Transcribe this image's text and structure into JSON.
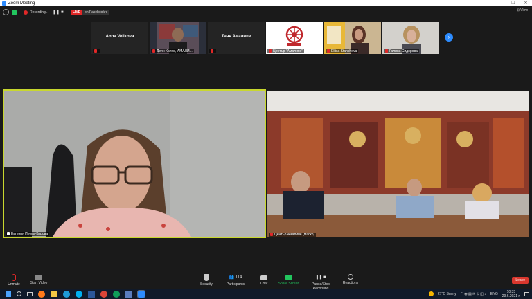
{
  "window": {
    "title": "Zoom Meeting"
  },
  "status": {
    "recording_label": "Recording...",
    "live_label": "LIVE",
    "live_target": "on Facebook",
    "view_label": "View"
  },
  "thumbnails": [
    {
      "name": "Anna Velikova",
      "label": ""
    },
    {
      "name": "",
      "label": "Деян Колев, АМАЛИ..."
    },
    {
      "name": "Таня Амалипе",
      "label": ""
    },
    {
      "name": "",
      "label": "Център \"Амалипе\""
    },
    {
      "name": "",
      "label": "Elitsa Stancheva"
    },
    {
      "name": "",
      "label": "Галина Сидорова"
    }
  ],
  "main_tiles": {
    "left_label": "Евгения Пеева-Кирова",
    "right_label": "Център Амалипе (Наско)"
  },
  "toolbar": {
    "unmute": "Unmute",
    "start_video": "Start Video",
    "security": "Security",
    "participants": "Participants",
    "participants_count": "114",
    "chat": "Chat",
    "share_screen": "Share Screen",
    "pause_recording": "Pause/Stop Recording",
    "reactions": "Reactions",
    "leave": "Leave"
  },
  "taskbar": {
    "weather": "27°C  Sunny",
    "language": "ENG",
    "time": "10:35",
    "date": "29.6.2021 г."
  },
  "colors": {
    "active_speaker_border": "#c8d72e",
    "live_red": "#e02828",
    "share_green": "#22c55e",
    "leave_red": "#d9372d",
    "zoom_blue": "#2d8cff"
  }
}
